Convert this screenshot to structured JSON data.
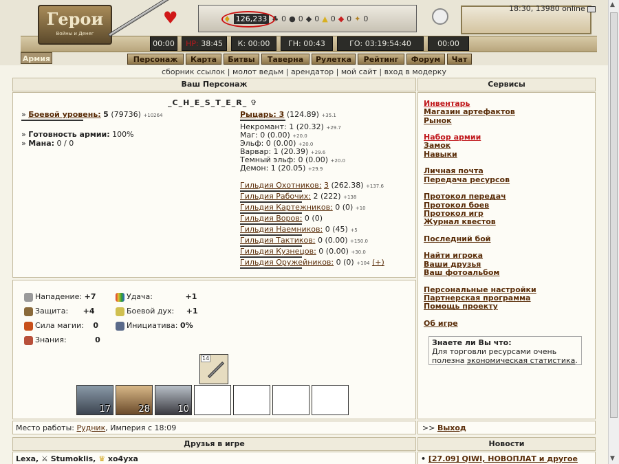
{
  "header": {
    "logo_title": "Герои",
    "logo_subtitle": "Войны и Денег",
    "resources": {
      "gold": "126,233",
      "wood": "0",
      "ore": "0",
      "mercury": "0",
      "sulfur": "0",
      "crystals": "0",
      "gems": "0"
    },
    "time_online": "18:30, 13980 online",
    "timers": [
      "00:00",
      "38:45",
      "К: 00:00",
      "ГН: 00:43",
      "ГО: 03:19:54:40",
      "00:00"
    ],
    "timer_hp_prefix": "НР:",
    "army_tab": "Армия",
    "nav": [
      "Персонаж",
      "Карта",
      "Битвы",
      "Таверна",
      "Рулетка",
      "Рейтинг",
      "Форум",
      "Чат"
    ],
    "sublinks": [
      "сборник ссылок",
      "молот ведьм",
      "арендатор",
      "мой сайт",
      "вход в модерку"
    ]
  },
  "character": {
    "panel_title": "Ваш Персонаж",
    "name": "_C_H_E_S_T_E_R_",
    "combat_label": "Боевой уровень:",
    "combat_level": "5",
    "combat_exp": "(79736)",
    "combat_delta": "+10264",
    "army_ready_label": "Готовность армии:",
    "army_ready": "100%",
    "mana_label": "Мана:",
    "mana": "0 / 0",
    "factions": [
      {
        "name": "Рыцарь: 3",
        "value": "(124.89)",
        "delta": "+35.1",
        "link": true
      },
      {
        "name": "Некромант: 1",
        "value": "(20.32)",
        "delta": "+29.7"
      },
      {
        "name": "Маг: 0",
        "value": "(0.00)",
        "delta": "+20.0"
      },
      {
        "name": "Эльф: 0",
        "value": "(0.00)",
        "delta": "+20.0"
      },
      {
        "name": "Варвар: 1",
        "value": "(20.39)",
        "delta": "+29.6"
      },
      {
        "name": "Темный эльф: 0",
        "value": "(0.00)",
        "delta": "+20.0"
      },
      {
        "name": "Демон: 1",
        "value": "(20.05)",
        "delta": "+29.9"
      }
    ],
    "guilds": [
      {
        "name": "Гильдия Охотников:",
        "level": "3",
        "value": "(262.38)",
        "delta": "+137.6"
      },
      {
        "name": "Гильдия Рабочих:",
        "level": "2",
        "value": "(222)",
        "delta": "+138"
      },
      {
        "name": "Гильдия Картежников:",
        "level": "0",
        "value": "(0)",
        "delta": "+10"
      },
      {
        "name": "Гильдия Воров:",
        "level": "0",
        "value": "(0)",
        "delta": ""
      },
      {
        "name": "Гильдия Наемников:",
        "level": "0",
        "value": "(45)",
        "delta": "+5"
      },
      {
        "name": "Гильдия Тактиков:",
        "level": "0",
        "value": "(0.00)",
        "delta": "+150.0"
      },
      {
        "name": "Гильдия Кузнецов:",
        "level": "0",
        "value": "(0.00)",
        "delta": "+30.0"
      },
      {
        "name": "Гильдия Оружейников:",
        "level": "0",
        "value": "(0)",
        "delta": "+104",
        "extra": "(+)"
      }
    ]
  },
  "stats": {
    "attack_label": "Нападение:",
    "attack": "+7",
    "defense_label": "Защита:",
    "defense": "+4",
    "spellpower_label": "Сила магии:",
    "spellpower": "0",
    "knowledge_label": "Знания:",
    "knowledge": "0",
    "luck_label": "Удача:",
    "luck": "+1",
    "morale_label": "Боевой дух:",
    "morale": "+1",
    "initiative_label": "Инициатива:",
    "initiative": "0%",
    "item_durability": "14",
    "army": [
      {
        "count": "17",
        "color": "#6a7888"
      },
      {
        "count": "28",
        "color": "#a88868"
      },
      {
        "count": "10",
        "color": "#707880"
      }
    ]
  },
  "workplace": {
    "label": "Место работы:",
    "place": "Рудник",
    "rest": ", Империя с 18:09",
    "exit_prefix": ">>",
    "exit": "Выход"
  },
  "friends": {
    "title": "Друзья в игре",
    "list": [
      "Lexa",
      "Stumoklis",
      "xo4yxa"
    ]
  },
  "services": {
    "title": "Сервисы",
    "groups": [
      [
        {
          "label": "Инвентарь",
          "red": true
        },
        {
          "label": "Магазин артефактов"
        },
        {
          "label": "Рынок"
        }
      ],
      [
        {
          "label": "Набор армии",
          "red": true
        },
        {
          "label": "Замок"
        },
        {
          "label": "Навыки"
        }
      ],
      [
        {
          "label": "Личная почта"
        },
        {
          "label": "Передача ресурсов"
        }
      ],
      [
        {
          "label": "Протокол передач"
        },
        {
          "label": "Протокол боев"
        },
        {
          "label": "Протокол игр"
        },
        {
          "label": "Журнал квестов"
        }
      ],
      [
        {
          "label": "Последний бой"
        }
      ],
      [
        {
          "label": "Найти игрока"
        },
        {
          "label": "Ваши друзья"
        },
        {
          "label": "Ваш фотоальбом"
        }
      ],
      [
        {
          "label": "Персональные настройки"
        },
        {
          "label": "Партнерская программа"
        },
        {
          "label": "Помощь проекту"
        }
      ],
      [
        {
          "label": "Об игре"
        }
      ]
    ],
    "tip_title": "Знаете ли Вы что:",
    "tip_text": "Для торговли ресурсами очень полезна",
    "tip_link": "экономическая статистика",
    "tip_end": "."
  },
  "news": {
    "title": "Новости",
    "items": [
      "[27.09] QIWI, НОВОПЛАТ и другое"
    ]
  }
}
